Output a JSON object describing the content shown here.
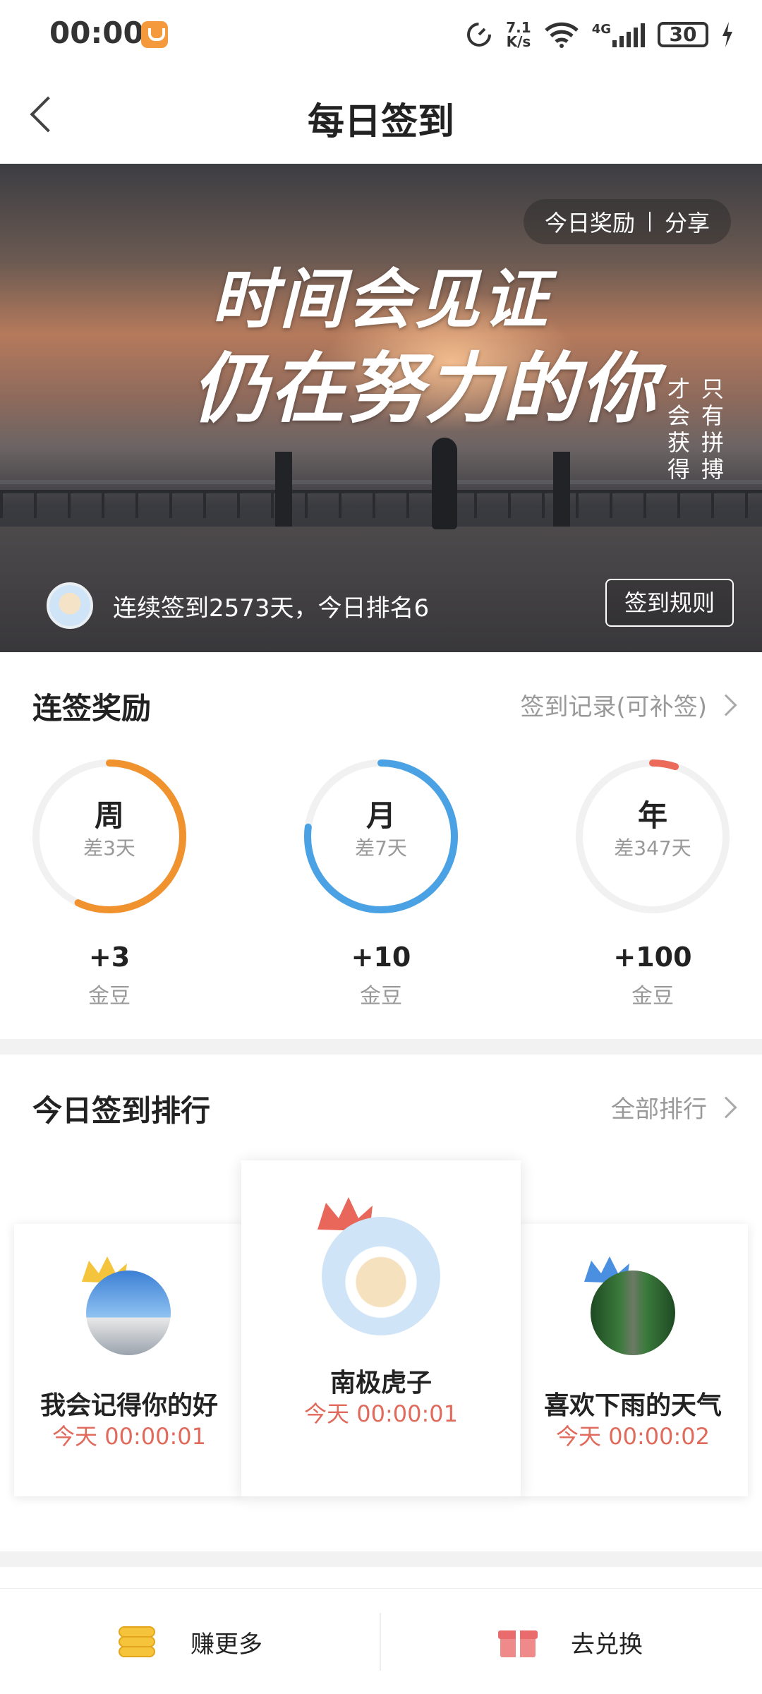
{
  "status_bar": {
    "time": "00:00",
    "speed_top": "7.1",
    "speed_unit": "K/s",
    "network": "4G",
    "battery": "30"
  },
  "header": {
    "title": "每日签到"
  },
  "banner": {
    "today_reward_label": "今日奖励",
    "share_label": "分享",
    "headline_1": "时间会见证",
    "headline_2": "仍在努力的你",
    "vertical_left": [
      "才",
      "会",
      "获",
      "得"
    ],
    "vertical_right": [
      "只",
      "有",
      "拼",
      "搏"
    ],
    "streak_text": "连续签到2573天，今日排名6",
    "rules_button": "签到规则"
  },
  "streak_rewards": {
    "title": "连签奖励",
    "link": "签到记录(可补签)",
    "items": [
      {
        "label": "周",
        "remaining": "差3天",
        "reward": "+3",
        "unit": "金豆",
        "progress": 0.57,
        "color": "#f0932e"
      },
      {
        "label": "月",
        "remaining": "差7天",
        "reward": "+10",
        "unit": "金豆",
        "progress": 0.77,
        "color": "#4aa1e3"
      },
      {
        "label": "年",
        "remaining": "差347天",
        "reward": "+100",
        "unit": "金豆",
        "progress": 0.05,
        "color": "#ec6a5a"
      }
    ]
  },
  "ranking": {
    "title": "今日签到排行",
    "link": "全部排行",
    "entries": [
      {
        "rank": 1,
        "name": "南极虎子",
        "time": "今天 00:00:01",
        "crown_color": "#e8675a"
      },
      {
        "rank": 2,
        "name": "我会记得你的好",
        "time": "今天 00:00:01",
        "crown_color": "#f4c43c"
      },
      {
        "rank": 3,
        "name": "喜欢下雨的天气",
        "time": "今天 00:00:02",
        "crown_color": "#4a8fe0"
      }
    ]
  },
  "bottom_bar": {
    "earn_more": "赚更多",
    "redeem": "去兑换"
  }
}
